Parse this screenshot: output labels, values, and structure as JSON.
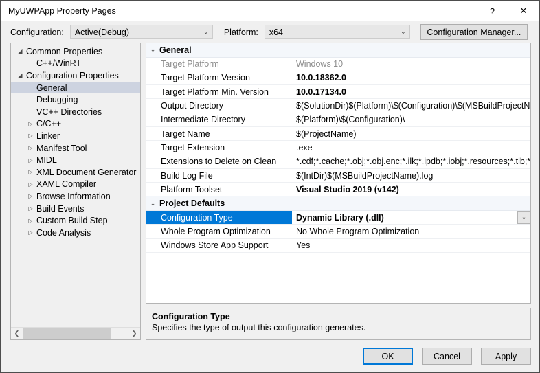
{
  "window": {
    "title": "MyUWPApp Property Pages",
    "help_icon": "?",
    "close_icon": "✕"
  },
  "toolbar": {
    "configuration_label": "Configuration:",
    "configuration_value": "Active(Debug)",
    "platform_label": "Platform:",
    "platform_value": "x64",
    "configuration_manager_label": "Configuration Manager...",
    "dropdown_icon": "⌄"
  },
  "tree": {
    "items": [
      {
        "label": "Common Properties",
        "depth": 1,
        "twisty": "◢",
        "selected": false
      },
      {
        "label": "C++/WinRT",
        "depth": 2,
        "twisty": "",
        "selected": false
      },
      {
        "label": "Configuration Properties",
        "depth": 1,
        "twisty": "◢",
        "selected": false
      },
      {
        "label": "General",
        "depth": 2,
        "twisty": "",
        "selected": true
      },
      {
        "label": "Debugging",
        "depth": 2,
        "twisty": "",
        "selected": false
      },
      {
        "label": "VC++ Directories",
        "depth": 2,
        "twisty": "",
        "selected": false
      },
      {
        "label": "C/C++",
        "depth": 2,
        "twisty": "▷",
        "selected": false
      },
      {
        "label": "Linker",
        "depth": 2,
        "twisty": "▷",
        "selected": false
      },
      {
        "label": "Manifest Tool",
        "depth": 2,
        "twisty": "▷",
        "selected": false
      },
      {
        "label": "MIDL",
        "depth": 2,
        "twisty": "▷",
        "selected": false
      },
      {
        "label": "XML Document Generator",
        "depth": 2,
        "twisty": "▷",
        "selected": false
      },
      {
        "label": "XAML Compiler",
        "depth": 2,
        "twisty": "▷",
        "selected": false
      },
      {
        "label": "Browse Information",
        "depth": 2,
        "twisty": "▷",
        "selected": false
      },
      {
        "label": "Build Events",
        "depth": 2,
        "twisty": "▷",
        "selected": false
      },
      {
        "label": "Custom Build Step",
        "depth": 2,
        "twisty": "▷",
        "selected": false
      },
      {
        "label": "Code Analysis",
        "depth": 2,
        "twisty": "▷",
        "selected": false
      }
    ],
    "scroll_left_icon": "❮",
    "scroll_right_icon": "❯"
  },
  "grid": {
    "expanded_icon": "⌄",
    "sections": [
      {
        "title": "General",
        "rows": [
          {
            "name": "Target Platform",
            "value": "Windows 10",
            "disabled": true,
            "bold": false,
            "selected": false,
            "dropdown": false
          },
          {
            "name": "Target Platform Version",
            "value": "10.0.18362.0",
            "disabled": false,
            "bold": true,
            "selected": false,
            "dropdown": false
          },
          {
            "name": "Target Platform Min. Version",
            "value": "10.0.17134.0",
            "disabled": false,
            "bold": true,
            "selected": false,
            "dropdown": false
          },
          {
            "name": "Output Directory",
            "value": "$(SolutionDir)$(Platform)\\$(Configuration)\\$(MSBuildProjectName)\\",
            "disabled": false,
            "bold": false,
            "selected": false,
            "dropdown": false
          },
          {
            "name": "Intermediate Directory",
            "value": "$(Platform)\\$(Configuration)\\",
            "disabled": false,
            "bold": false,
            "selected": false,
            "dropdown": false
          },
          {
            "name": "Target Name",
            "value": "$(ProjectName)",
            "disabled": false,
            "bold": false,
            "selected": false,
            "dropdown": false
          },
          {
            "name": "Target Extension",
            "value": ".exe",
            "disabled": false,
            "bold": false,
            "selected": false,
            "dropdown": false
          },
          {
            "name": "Extensions to Delete on Clean",
            "value": "*.cdf;*.cache;*.obj;*.obj.enc;*.ilk;*.ipdb;*.iobj;*.resources;*.tlb;*.tli;*.tlh",
            "disabled": false,
            "bold": false,
            "selected": false,
            "dropdown": false
          },
          {
            "name": "Build Log File",
            "value": "$(IntDir)$(MSBuildProjectName).log",
            "disabled": false,
            "bold": false,
            "selected": false,
            "dropdown": false
          },
          {
            "name": "Platform Toolset",
            "value": "Visual Studio 2019 (v142)",
            "disabled": false,
            "bold": true,
            "selected": false,
            "dropdown": false
          }
        ]
      },
      {
        "title": "Project Defaults",
        "rows": [
          {
            "name": "Configuration Type",
            "value": "Dynamic Library (.dll)",
            "disabled": false,
            "bold": true,
            "selected": true,
            "dropdown": true
          },
          {
            "name": "Whole Program Optimization",
            "value": "No Whole Program Optimization",
            "disabled": false,
            "bold": false,
            "selected": false,
            "dropdown": false
          },
          {
            "name": "Windows Store App Support",
            "value": "Yes",
            "disabled": false,
            "bold": false,
            "selected": false,
            "dropdown": false
          }
        ]
      }
    ]
  },
  "description": {
    "title": "Configuration Type",
    "text": "Specifies the type of output this configuration generates."
  },
  "footer": {
    "ok_label": "OK",
    "cancel_label": "Cancel",
    "apply_label": "Apply"
  },
  "colors": {
    "selection_blue": "#0078d7",
    "tree_selection": "#cdd3e0",
    "dialog_background": "#f0f0f0"
  }
}
